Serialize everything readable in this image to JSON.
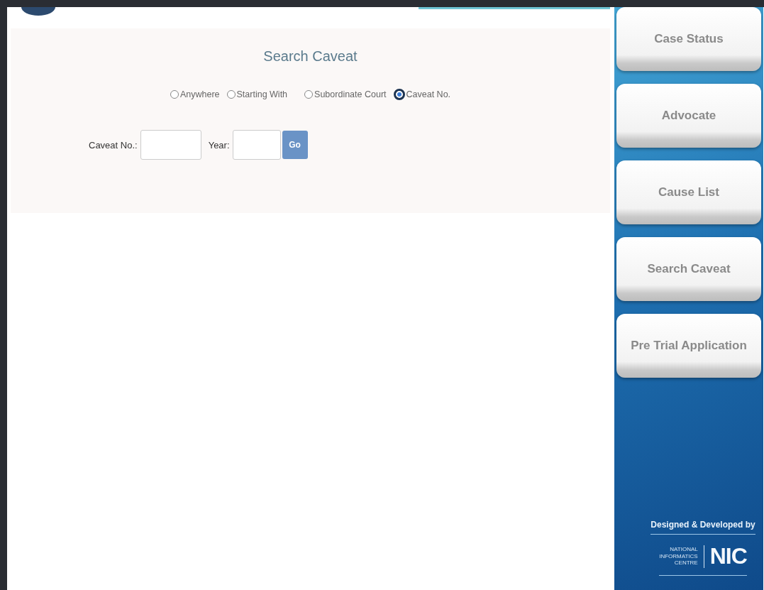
{
  "search_panel": {
    "title": "Search Caveat",
    "search_options": [
      {
        "label": "Anywhere",
        "selected": false
      },
      {
        "label": "Starting With",
        "selected": false
      },
      {
        "label": "Subordinate Court",
        "selected": false
      },
      {
        "label": "Caveat No.",
        "selected": true
      }
    ],
    "fields": [
      {
        "label": "Caveat No.:"
      },
      {
        "label": "Year:"
      }
    ],
    "submit_button": "Go"
  },
  "sidebar": {
    "items": [
      {
        "label": "Case Status"
      },
      {
        "label": "Advocate"
      },
      {
        "label": "Cause List"
      },
      {
        "label": "Search Caveat"
      },
      {
        "label": "Pre Trial Application"
      }
    ],
    "credit": "Designed & Developed by",
    "org_name": [
      "NATIONAL",
      "INFORMATICS",
      "CENTRE"
    ],
    "org_logo": "NIC"
  }
}
